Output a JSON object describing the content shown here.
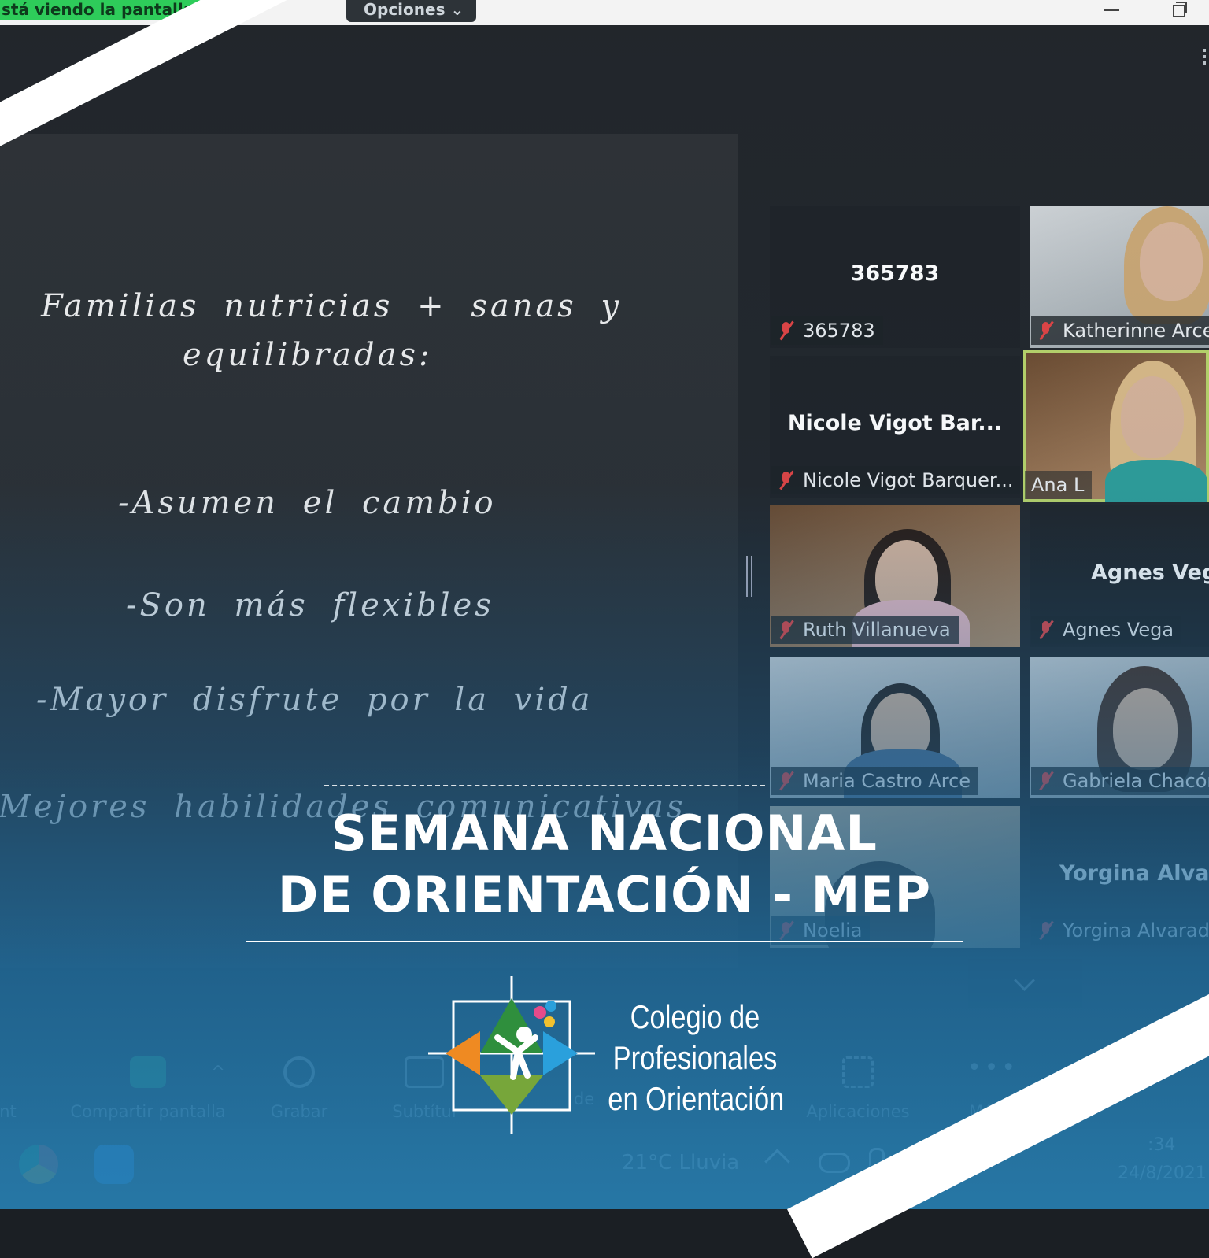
{
  "share_bar": {
    "banner_text": "stá viendo la pantalla d",
    "options_label": "Opciones ⌄"
  },
  "slide": {
    "lines": [
      "Familias nutricias + sanas y",
      "equilibradas:",
      "-Asumen el cambio",
      "-Son más flexibles",
      "-Mayor disfrute por la vida",
      "Mejores habilidades comunicativas"
    ]
  },
  "participants": [
    {
      "center": "365783",
      "label": "365783",
      "muted": true
    },
    {
      "center": "",
      "label": "Katherinne Arce",
      "muted": true
    },
    {
      "center": "Nicole Vigot Bar...",
      "label": "Nicole Vigot Barquer...",
      "muted": true
    },
    {
      "center": "",
      "label": "Ana L",
      "muted": false,
      "active": true
    },
    {
      "center": "",
      "label": "Ruth Villanueva",
      "muted": true
    },
    {
      "center": "Agnes Veg",
      "label": "Agnes Vega",
      "muted": true
    },
    {
      "center": "",
      "label": "Maria Castro Arce",
      "muted": true
    },
    {
      "center": "",
      "label": "Gabriela Chacón",
      "muted": true
    },
    {
      "center": "",
      "label": "Noelia",
      "muted": true
    },
    {
      "center": "Yorgina Alvar",
      "label": "Yorgina Alvarad",
      "muted": true
    }
  ],
  "toolbar": {
    "share": "Compartir pantalla",
    "record": "Grabar",
    "subtitles": "Subtítul",
    "apps": "Aplicaciones",
    "more": "Más",
    "partial_left": "nt",
    "partial_mid": "de"
  },
  "taskbar": {
    "weather": "21°C  Lluvia",
    "time": ":34",
    "date": "24/8/2021"
  },
  "headline": {
    "line1": "SEMANA NACIONAL",
    "line2": "DE ORIENTACIÓN - MEP"
  },
  "logo": {
    "line1": "Colegio de",
    "line2": "Profesionales",
    "line3": "en Orientación"
  },
  "colors": {
    "active_speaker": "#b8d46a",
    "muted_icon": "#e04444",
    "share_banner": "#2ecc5a",
    "brand_blue": "#267daf"
  }
}
